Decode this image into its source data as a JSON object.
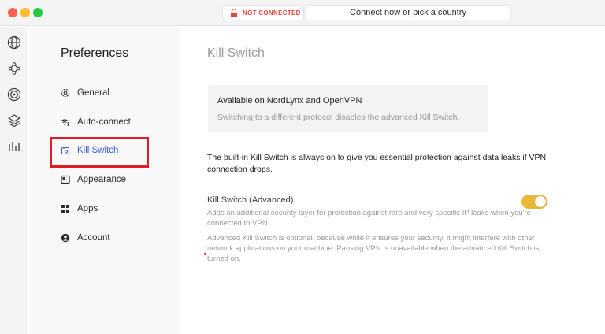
{
  "titlebar": {
    "status_text": "NOT CONNECTED",
    "status_color": "#e0453a",
    "connect_prompt": "Connect now or pick a country"
  },
  "rail": {
    "icons": [
      "globe-icon",
      "meshnet-icon",
      "target-icon",
      "layers-icon",
      "stats-icon"
    ]
  },
  "sidebar": {
    "title": "Preferences",
    "items": [
      {
        "label": "General",
        "icon": "gear-icon"
      },
      {
        "label": "Auto-connect",
        "icon": "wifi-bolt-icon"
      },
      {
        "label": "Kill Switch",
        "icon": "kill-switch-icon",
        "active": true
      },
      {
        "label": "Appearance",
        "icon": "appearance-icon"
      },
      {
        "label": "Apps",
        "icon": "apps-icon"
      },
      {
        "label": "Account",
        "icon": "account-icon"
      }
    ]
  },
  "main": {
    "title": "Kill Switch",
    "info_card": {
      "title": "Available on NordLynx and OpenVPN",
      "subtitle": "Switching to a different protocol disables the advanced Kill Switch."
    },
    "builtin_text": "The built-in Kill Switch is always on to give you essential protection against data leaks if VPN connection drops.",
    "advanced": {
      "title": "Kill Switch (Advanced)",
      "description": "Adds an additional security layer for protection against rare and very specific IP leaks when you're connected to VPN.",
      "note": "Advanced Kill Switch is optional, because while it ensures your security, it might interfere with other network applications on your machine. Pausing VPN is unavailable when the advanced Kill Switch is turned on.",
      "enabled": true
    }
  },
  "colors": {
    "accent": "#3e5fd6",
    "toggle_on": "#e9b838",
    "highlight": "#e11d2a"
  }
}
